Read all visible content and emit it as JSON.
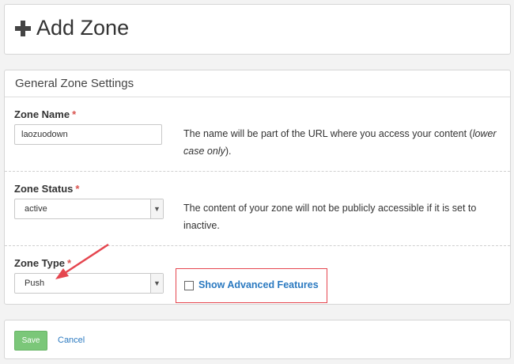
{
  "header": {
    "title": "Add Zone",
    "icon": "plus-icon"
  },
  "settings": {
    "heading": "General Zone Settings",
    "zone_name": {
      "label": "Zone Name",
      "required_mark": "*",
      "value": "laozuodown",
      "help_prefix": "The name will be part of the URL where you access your content (",
      "help_em": "lower case only",
      "help_suffix": ")."
    },
    "zone_status": {
      "label": "Zone Status",
      "required_mark": "*",
      "selected": "active",
      "help": "The content of your zone will not be publicly accessible if it is set to inactive."
    },
    "zone_type": {
      "label": "Zone Type",
      "required_mark": "*",
      "selected": "Push"
    },
    "advanced": {
      "label": "Show Advanced Features",
      "checked": false
    }
  },
  "footer": {
    "save_label": "Save",
    "cancel_label": "Cancel"
  },
  "colors": {
    "accent_link": "#2a79c0",
    "save_button": "#7bc779",
    "required": "#d9534f",
    "annotation": "#e5464f"
  }
}
